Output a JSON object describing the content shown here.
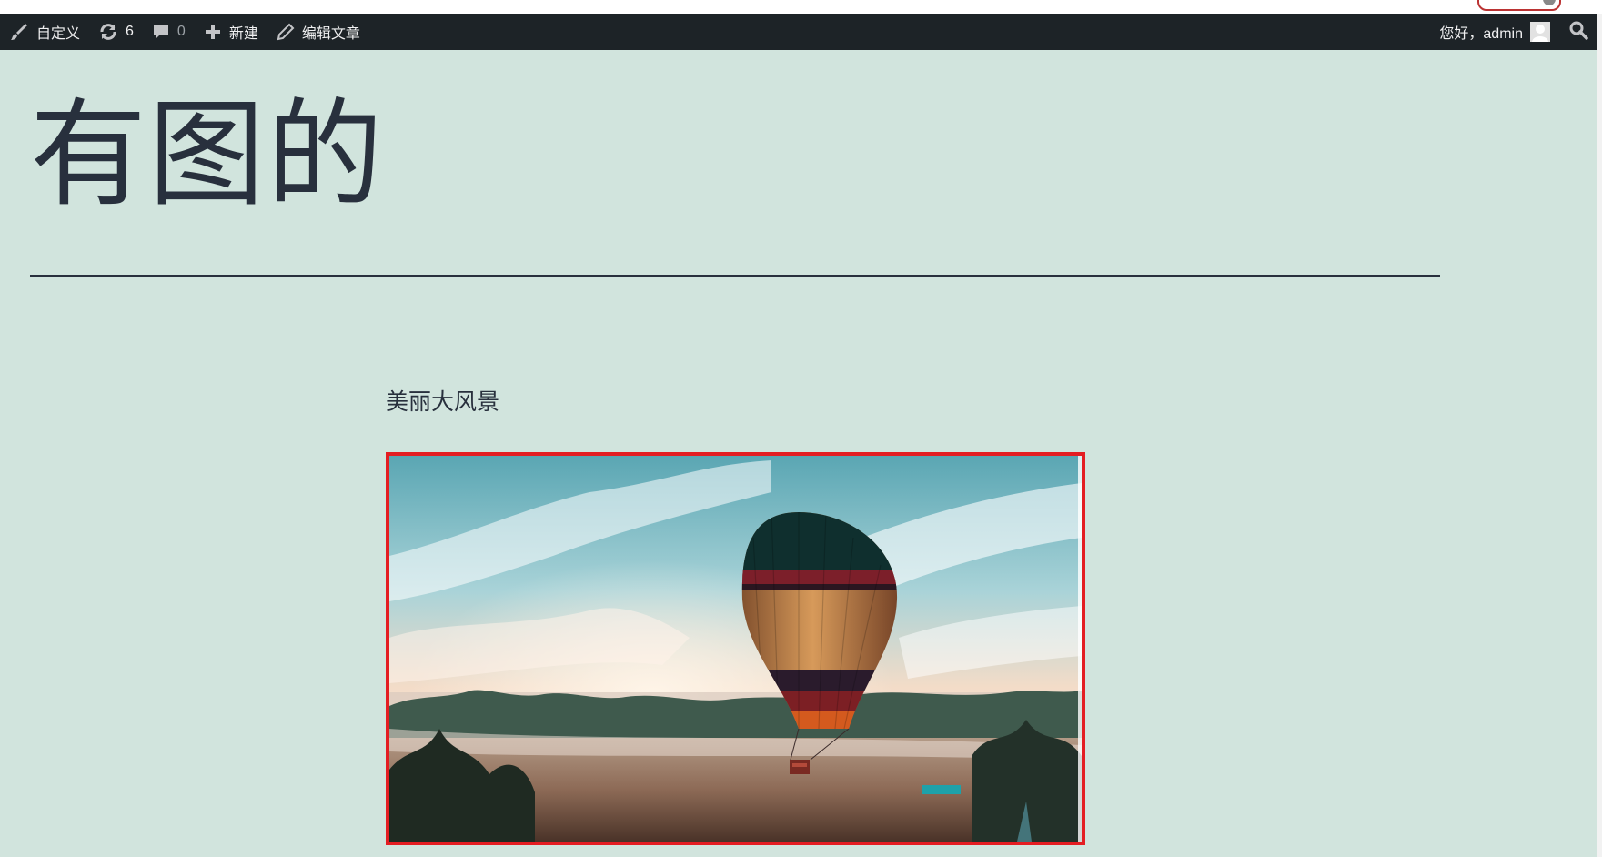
{
  "admin_bar": {
    "customize_label": "自定义",
    "updates_count": "6",
    "comments_count": "0",
    "new_label": "新建",
    "edit_post_label": "编辑文章",
    "greeting": "您好，admin"
  },
  "post": {
    "title": "有图的",
    "paragraph": "美丽大风景"
  },
  "colors": {
    "admin_bar_bg": "#1d2327",
    "page_bg": "#d1e4dd",
    "text": "#28303d",
    "image_highlight_border": "#e41d22"
  },
  "icons": [
    "brush-icon",
    "updates-icon",
    "comment-icon",
    "plus-icon",
    "pencil-icon",
    "avatar",
    "search-icon"
  ]
}
